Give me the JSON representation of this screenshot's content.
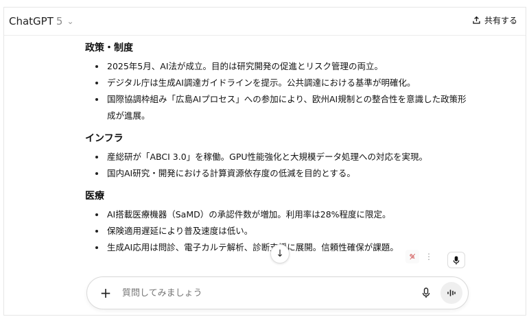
{
  "header": {
    "model_name": "ChatGPT",
    "model_version": "5",
    "share_label": "共有する"
  },
  "sections": [
    {
      "title": "政策・制度",
      "items": [
        "2025年5月、AI法が成立。目的は研究開発の促進とリスク管理の両立。",
        "デジタル庁は生成AI調達ガイドラインを提示。公共調達における基準が明確化。",
        "国際協調枠組み「広島AIプロセス」への参加により、欧州AI規制との整合性を意識した政策形成が進展。"
      ]
    },
    {
      "title": "インフラ",
      "items": [
        "産総研が「ABCI 3.0」を稼働。GPU性能強化と大規模データ処理への対応を実現。",
        "国内AI研究・開発における計算資源依存度の低減を目的とする。"
      ]
    },
    {
      "title": "医療",
      "items": [
        "AI搭載医療機器（SaMD）の承認件数が増加。利用率は28%程度に限定。",
        "保険適用遅延により普及速度は低い。",
        "生成AI応用は問診、電子カルテ解析、診断支援に展開。信頼性確保が課題。"
      ]
    }
  ],
  "composer": {
    "placeholder": "質問してみましょう"
  },
  "icons": {
    "share": "share-icon",
    "chevron": "chevron-down-icon",
    "plus": "plus-icon",
    "mic": "microphone-icon",
    "voice": "voice-mode-icon",
    "scroll": "arrow-down-icon"
  }
}
